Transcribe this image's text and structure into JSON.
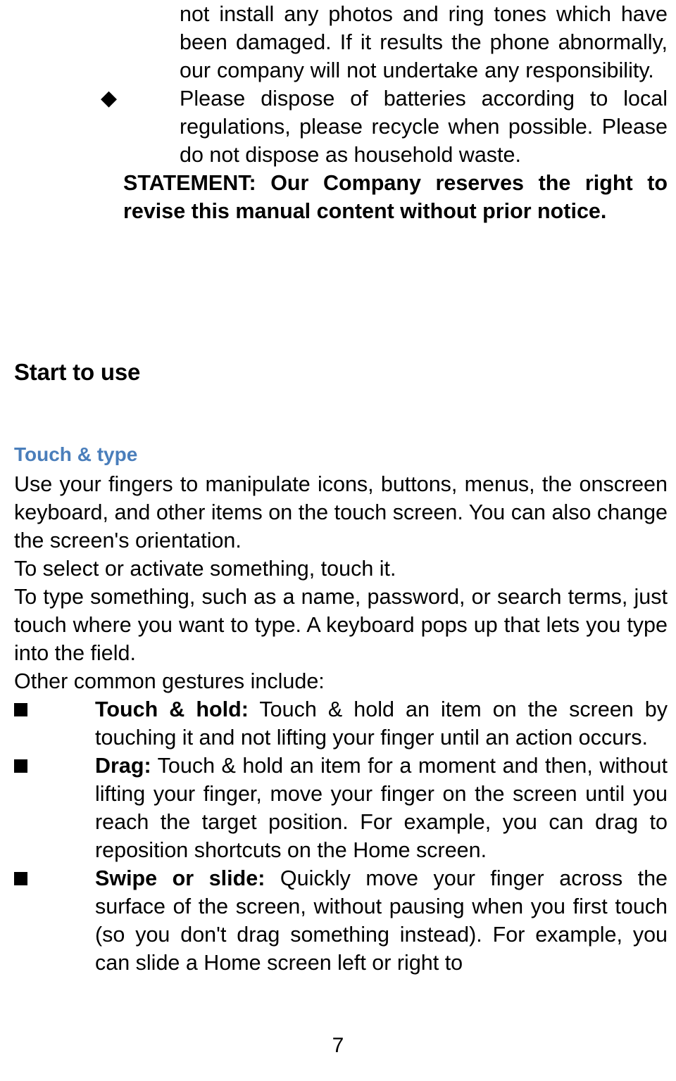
{
  "document": {
    "type": "user-manual-page",
    "page_number": "7"
  },
  "top_block": {
    "continuation_paragraph": "not install any photos and ring tones which have been damaged. If it results the phone abnormally, our company will not undertake any responsibility.",
    "diamond_bullet_glyph": "◆",
    "battery_bullet": "Please dispose of batteries according to local regulations, please recycle when possible. Please do not dispose as household waste.",
    "statement_label": "STATEMENT",
    "statement_separator": ": ",
    "statement_text": "Our Company reserves the right to revise this manual content without prior notice."
  },
  "section": {
    "title": "Start to use",
    "subtitle": "Touch & type",
    "subtitle_color": "#4a7ebb",
    "paragraphs": [
      "Use your fingers to manipulate icons, buttons, menus, the onscreen keyboard, and other items on the touch screen. You can also change the screen's orientation.",
      "To select or activate something, touch it.",
      "To type something, such as a name, password, or search terms, just touch where you want to type. A keyboard pops up that lets you type into the field.",
      "Other common gestures include:"
    ],
    "square_bullet_glyph": "■",
    "gestures": [
      {
        "term": "Touch & hold:",
        "description": " Touch & hold an item on the screen by touching it and not lifting your finger until an action occurs."
      },
      {
        "term": "Drag:",
        "description": " Touch & hold an item for a moment and then, without lifting your finger, move your finger on the screen until you reach the target position. For example, you can drag to reposition shortcuts on the Home screen."
      },
      {
        "term": "Swipe or slide:",
        "description": " Quickly move your finger across the surface of the screen, without pausing when you first touch (so you don't drag something instead). For example, you can slide a Home screen left or right to"
      }
    ]
  }
}
